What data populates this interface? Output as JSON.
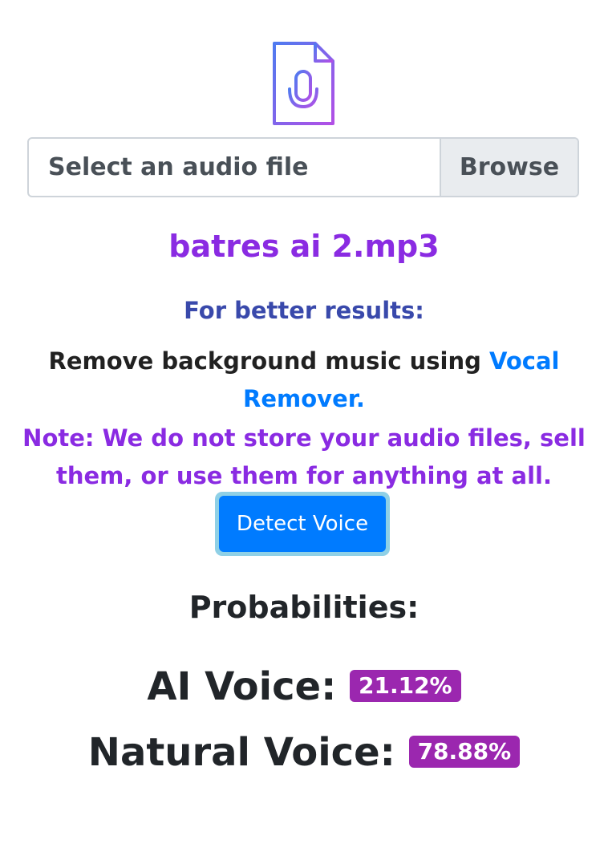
{
  "icon": {
    "name": "audio-file-icon"
  },
  "upload": {
    "placeholder": "Select an audio file",
    "browse_label": "Browse"
  },
  "selected_file": "batres ai 2.mp3",
  "tips": {
    "heading": "For better results:",
    "remove_prefix": "Remove background music using ",
    "remove_link": "Vocal Remover.",
    "note": "Note: We do not store your audio files, sell them, or use them for anything at all."
  },
  "detect_button": "Detect Voice",
  "probabilities": {
    "title": "Probabilities:",
    "ai_label": "AI Voice:",
    "ai_value": "21.12%",
    "natural_label": "Natural Voice:",
    "natural_value": "78.88%"
  },
  "colors": {
    "accent": "#8a2be2",
    "link": "#007bff",
    "heading_blue": "#3949ab",
    "badge": "#9b27af"
  }
}
